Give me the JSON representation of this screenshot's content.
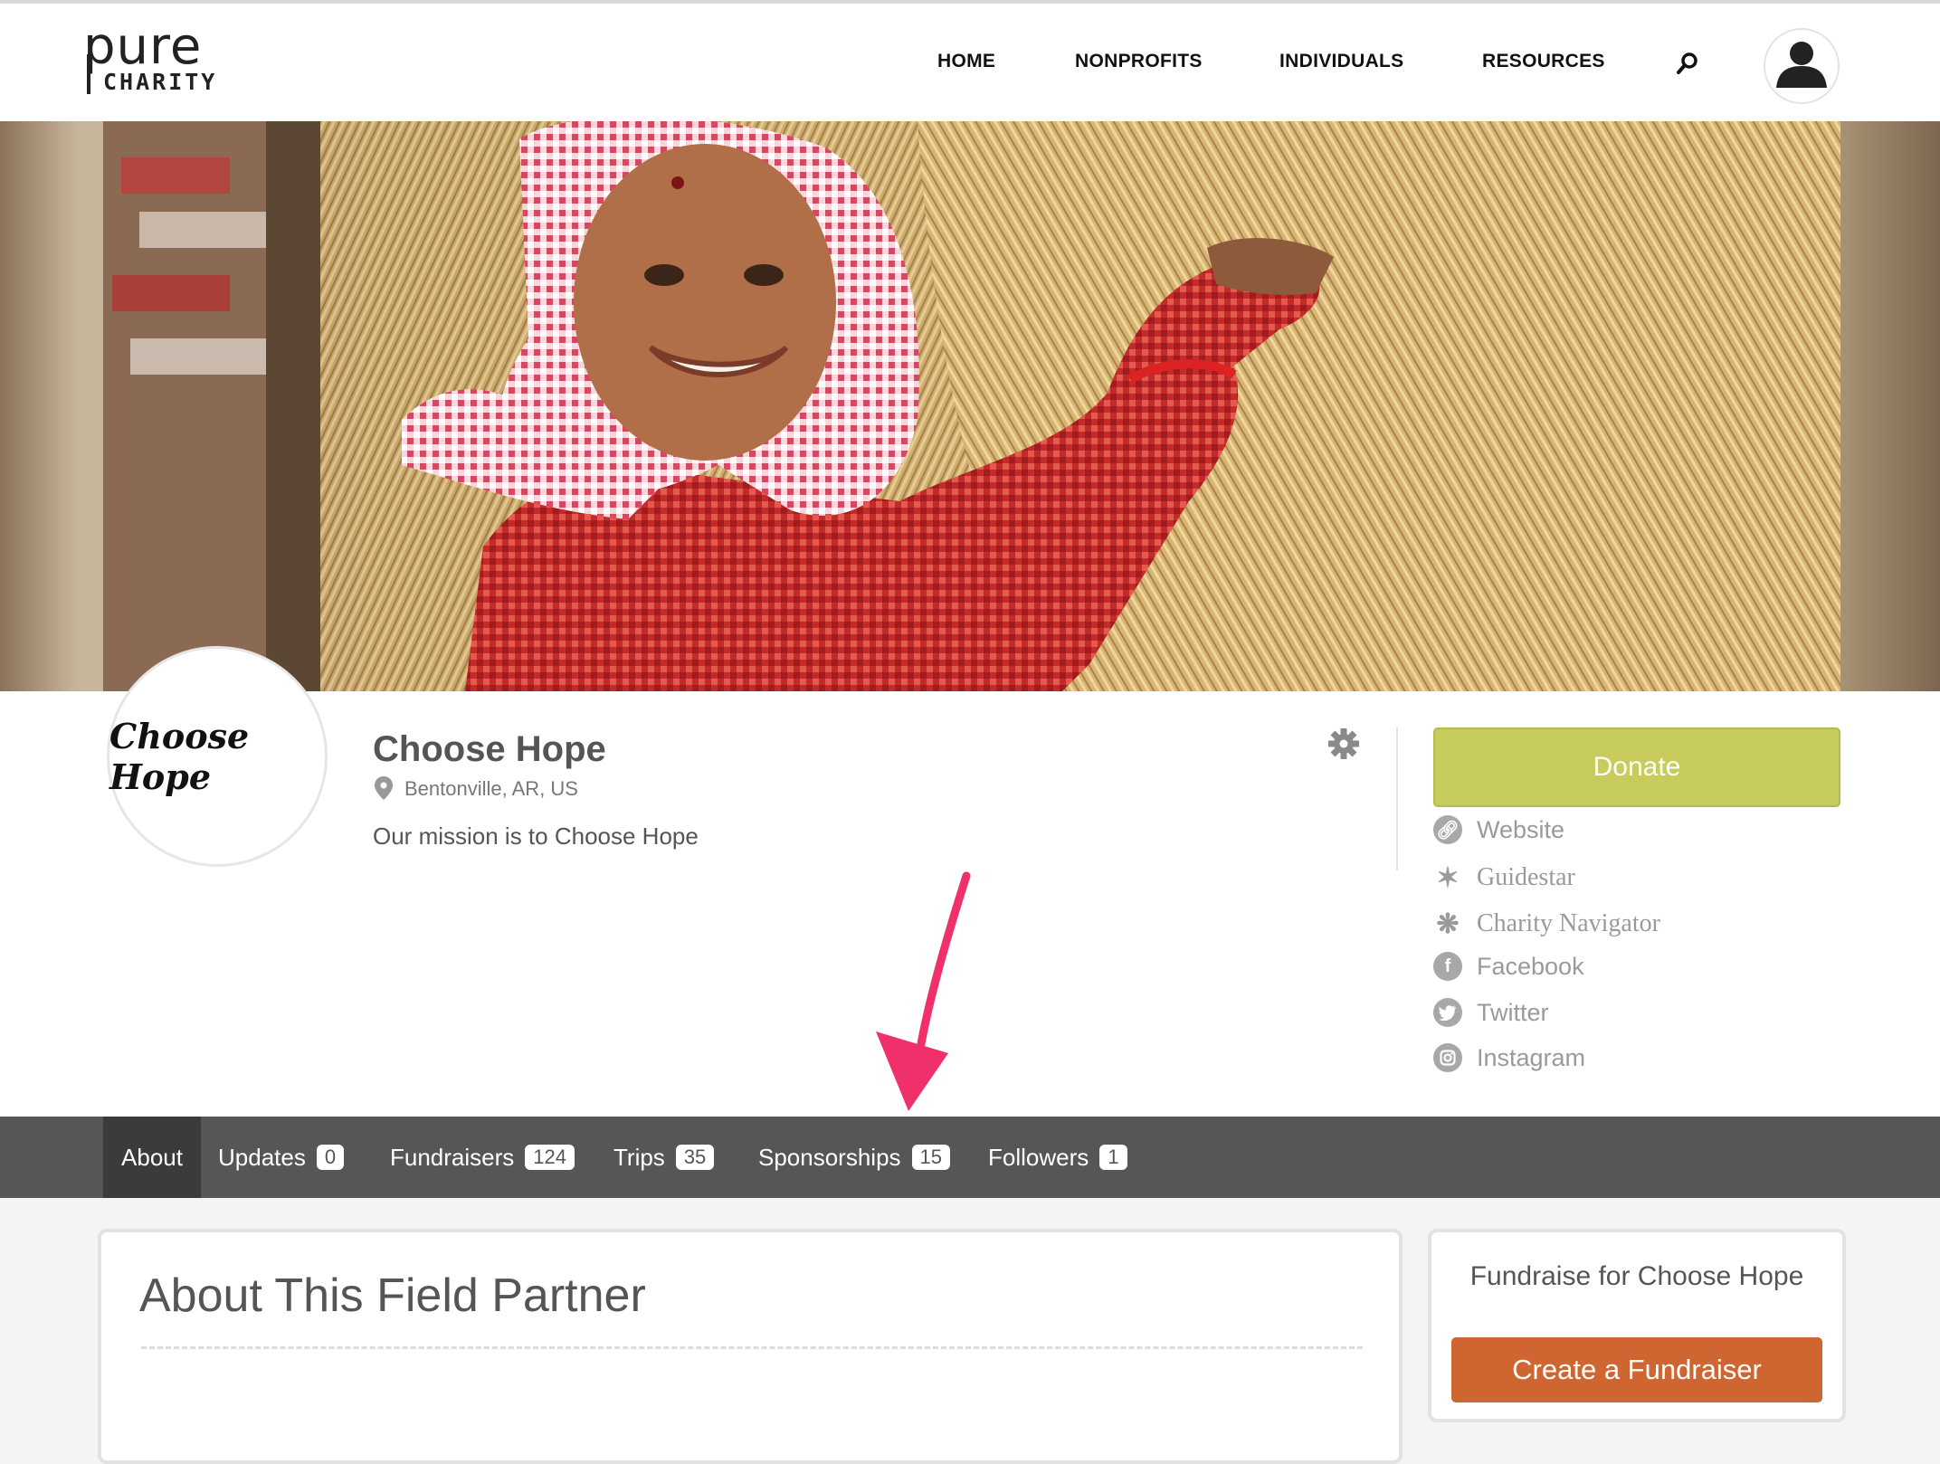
{
  "header": {
    "logo_line1": "pure",
    "logo_line2": "CHARITY",
    "nav": [
      "HOME",
      "NONPROFITS",
      "INDIVIDUALS",
      "RESOURCES"
    ]
  },
  "org": {
    "logo_text": "Choose Hope",
    "name": "Choose Hope",
    "location": "Bentonville, AR, US",
    "mission": "Our mission is to Choose Hope"
  },
  "sidebar": {
    "donate_label": "Donate",
    "links": [
      "Website",
      "Guidestar",
      "Charity Navigator",
      "Facebook",
      "Twitter",
      "Instagram"
    ]
  },
  "tabs": [
    {
      "label": "About",
      "count": null
    },
    {
      "label": "Updates",
      "count": "0"
    },
    {
      "label": "Fundraisers",
      "count": "124"
    },
    {
      "label": "Trips",
      "count": "35"
    },
    {
      "label": "Sponsorships",
      "count": "15"
    },
    {
      "label": "Followers",
      "count": "1"
    }
  ],
  "about": {
    "title": "About This Field Partner"
  },
  "fundraise": {
    "title": "Fundraise for Choose Hope",
    "create_label": "Create a Fundraiser"
  },
  "colors": {
    "donate": "#c7cc5c",
    "create": "#cf6530",
    "tabbar": "#555658",
    "arrow": "#f0306a"
  }
}
